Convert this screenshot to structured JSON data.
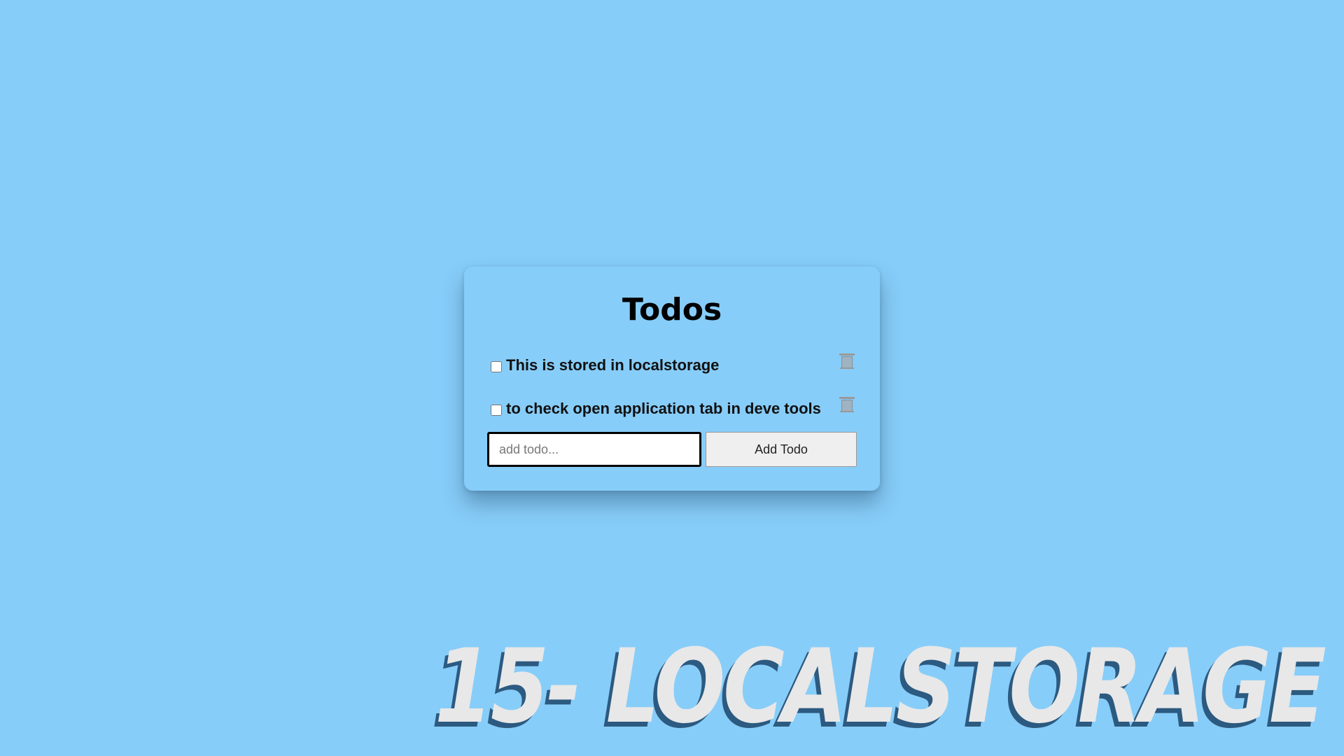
{
  "app": {
    "title": "Todos"
  },
  "todos": [
    {
      "text": "This is stored in localstorage",
      "checked": false,
      "delete_icon": "trash-icon"
    },
    {
      "text": "to check open application tab in deve tools",
      "checked": false,
      "delete_icon": "trash-icon"
    }
  ],
  "add_form": {
    "placeholder": "add todo...",
    "value": "",
    "button_label": "Add Todo"
  },
  "banner": {
    "text": "15- LOCALSTORAGE"
  },
  "colors": {
    "background": "#87cdf9",
    "banner_text": "#e8e8e8",
    "banner_shadow": "#2c5a80"
  }
}
